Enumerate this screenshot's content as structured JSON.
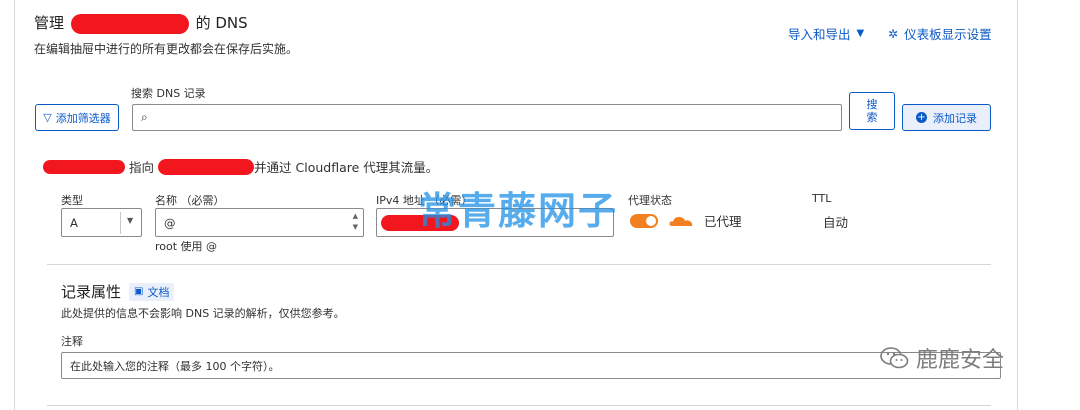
{
  "header": {
    "title_prefix": "管理",
    "title_suffix": "的 DNS",
    "subtitle": "在编辑抽屉中进行的所有更改都会在保存后实施。",
    "import_export_label": "导入和导出",
    "dashboard_settings_label": "仪表板显示设置"
  },
  "toolbar": {
    "filter_button_label": "添加筛选器",
    "search_label": "搜索 DNS 记录",
    "search_value": "",
    "search_button_label_line1": "搜",
    "search_button_label_line2": "索",
    "add_record_label": "添加记录"
  },
  "notice": {
    "text_part1": "指向",
    "text_part2": "并通过 Cloudflare 代理其流量。"
  },
  "record_form": {
    "type_label": "类型",
    "type_value": "A",
    "name_label": "名称 （必需）",
    "name_value": "@",
    "name_hint": "root 使用 @",
    "ipv4_label": "IPv4 地址 （必需）",
    "proxy_label": "代理状态",
    "proxy_value": "已代理",
    "ttl_label": "TTL",
    "ttl_value": "自动"
  },
  "attributes": {
    "heading": "记录属性",
    "docs_label": "文档",
    "description": "此处提供的信息不会影响 DNS 记录的解析，仅供您参考。",
    "comment_label": "注释",
    "comment_placeholder": "在此处输入您的注释（最多 100 个字符）。"
  },
  "overlays": {
    "watermark_text": "常青藤网子",
    "wechat_text": "鹿鹿安全"
  },
  "colors": {
    "accent": "#0b59c8",
    "proxy_orange": "#f38020",
    "redaction": "#f2171f"
  }
}
